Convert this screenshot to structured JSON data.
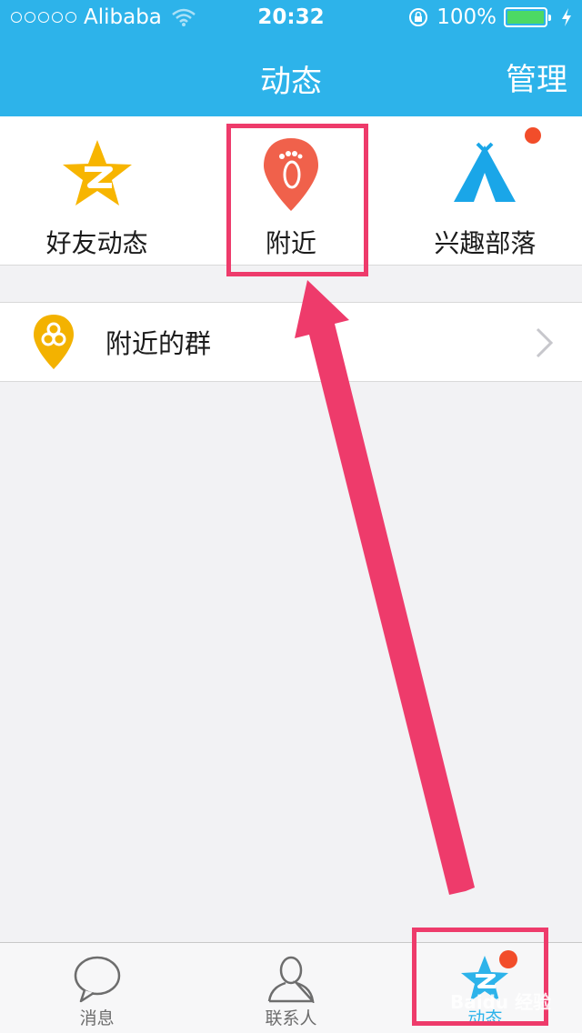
{
  "status_bar": {
    "carrier": "Alibaba",
    "time": "20:32",
    "battery": "100%"
  },
  "nav": {
    "title": "动态",
    "right_label": "管理"
  },
  "features": [
    {
      "label": "好友动态",
      "icon": "qzone-star-icon"
    },
    {
      "label": "附近",
      "icon": "footprint-pin-icon"
    },
    {
      "label": "兴趣部落",
      "icon": "tent-icon",
      "badge": true
    }
  ],
  "list": {
    "nearby_groups": {
      "label": "附近的群",
      "icon": "group-pin-icon"
    }
  },
  "tabs": [
    {
      "label": "消息",
      "icon": "chat-bubble-icon"
    },
    {
      "label": "联系人",
      "icon": "contact-person-icon"
    },
    {
      "label": "动态",
      "icon": "star-icon",
      "active": true,
      "badge": true
    }
  ],
  "watermark": "Baidu 经验",
  "colors": {
    "brand_blue": "#2db3ea",
    "badge_red": "#f24d2a",
    "annotation_pink": "#ee3b6b",
    "qzone_yellow": "#f7b500",
    "nearby_red": "#f0614b",
    "tent_blue": "#1aa6e8",
    "group_yellow": "#f3b200"
  }
}
